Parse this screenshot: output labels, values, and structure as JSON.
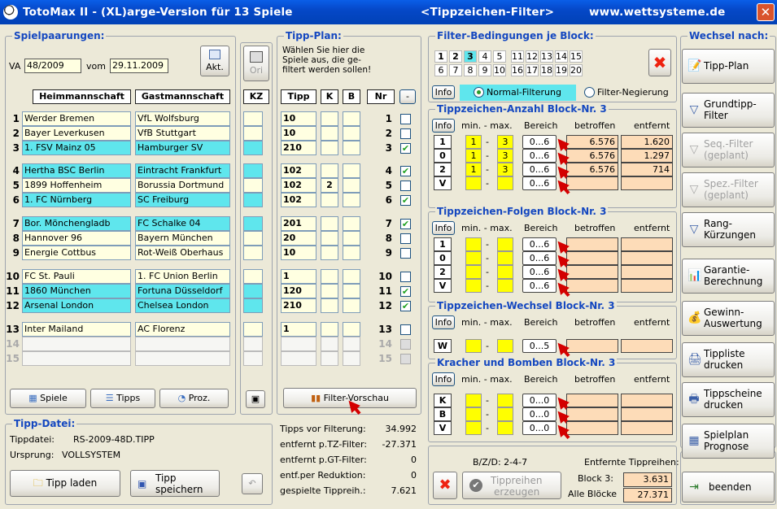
{
  "window": {
    "title": "TotoMax II - (XL)arge-Version für 13 Spiele",
    "subtitle": "<Tippzeichen-Filter>",
    "site": "www.wettsysteme.de",
    "close": "✕"
  },
  "spielpaarungen": {
    "legend": "Spielpaarungen:",
    "va_label": "VA",
    "va_value": "48/2009",
    "vom_label": "vom",
    "vom_value": "29.11.2009",
    "akt_label": "Akt.",
    "col_home": "Heimmannschaft",
    "col_away": "Gastmannschaft",
    "col_kz": "KZ",
    "ori_label": "Ori",
    "rows": [
      {
        "nr": "1",
        "home": "Werder Bremen",
        "away": "VfL Wolfsburg",
        "tipp": "10",
        "k": "",
        "b": "",
        "checked": false
      },
      {
        "nr": "2",
        "home": "Bayer Leverkusen",
        "away": "VfB Stuttgart",
        "tipp": "10",
        "k": "",
        "b": "",
        "checked": false
      },
      {
        "nr": "3",
        "home": "1. FSV Mainz 05",
        "away": "Hamburger SV",
        "tipp": "210",
        "k": "",
        "b": "",
        "checked": true
      },
      {
        "nr": "4",
        "home": "Hertha BSC Berlin",
        "away": "Eintracht Frankfurt",
        "tipp": "102",
        "k": "",
        "b": "",
        "checked": true
      },
      {
        "nr": "5",
        "home": "1899 Hoffenheim",
        "away": "Borussia Dortmund",
        "tipp": "102",
        "k": "2",
        "b": "",
        "checked": false
      },
      {
        "nr": "6",
        "home": "1. FC Nürnberg",
        "away": "SC Freiburg",
        "tipp": "102",
        "k": "",
        "b": "",
        "checked": true
      },
      {
        "nr": "7",
        "home": "Bor. Mönchengladb",
        "away": "FC Schalke 04",
        "tipp": "201",
        "k": "",
        "b": "",
        "checked": true
      },
      {
        "nr": "8",
        "home": "Hannover 96",
        "away": "Bayern München",
        "tipp": "20",
        "k": "",
        "b": "",
        "checked": false
      },
      {
        "nr": "9",
        "home": "Energie Cottbus",
        "away": "Rot-Weiß Oberhaus",
        "tipp": "10",
        "k": "",
        "b": "",
        "checked": false
      },
      {
        "nr": "10",
        "home": "FC St. Pauli",
        "away": "1. FC Union Berlin",
        "tipp": "1",
        "k": "",
        "b": "",
        "checked": false
      },
      {
        "nr": "11",
        "home": "1860 München",
        "away": "Fortuna Düsseldorf",
        "tipp": "120",
        "k": "",
        "b": "",
        "checked": true
      },
      {
        "nr": "12",
        "home": "Arsenal London",
        "away": "Chelsea London",
        "tipp": "210",
        "k": "",
        "b": "",
        "checked": true
      },
      {
        "nr": "13",
        "home": "Inter Mailand",
        "away": "AC Florenz",
        "tipp": "1",
        "k": "",
        "b": "",
        "checked": false
      },
      {
        "nr": "14",
        "home": "",
        "away": "",
        "tipp": "",
        "k": "",
        "b": "",
        "checked": false
      },
      {
        "nr": "15",
        "home": "",
        "away": "",
        "tipp": "",
        "k": "",
        "b": "",
        "checked": false
      }
    ],
    "btn_spiele": "Spiele",
    "btn_tipps": "Tipps",
    "btn_proz": "Proz."
  },
  "tippplan": {
    "legend": "Tipp-Plan:",
    "hint": "Wählen Sie hier die Spiele aus, die ge- filtert werden sollen!",
    "col_tipp": "Tipp",
    "col_k": "K",
    "col_b": "B",
    "col_nr": "Nr",
    "col_minus": "-",
    "btn_filter_vorschau": "Filter-Vorschau"
  },
  "tippdatei": {
    "legend": "Tipp-Datei:",
    "file_label": "Tippdatei:",
    "file_value": "RS-2009-48D.TIPP",
    "origin_label": "Ursprung:",
    "origin_value": "VOLLSYSTEM",
    "btn_laden": "Tipp laden",
    "btn_speichern_1": "Tipp",
    "btn_speichern_2": "speichern"
  },
  "stats": [
    {
      "label": "Tipps vor Filterung:",
      "value": "34.992"
    },
    {
      "label": "entfernt p.TZ-Filter:",
      "value": "-27.371"
    },
    {
      "label": "entfernt p.GT-Filter:",
      "value": "0"
    },
    {
      "label": "entf.per Reduktion:",
      "value": "0"
    },
    {
      "label": "gespielte Tippreih.:",
      "value": "7.621"
    }
  ],
  "filter": {
    "legend": "Filter-Bedingungen je Block:",
    "blocks_row1": [
      "1",
      "2",
      "3",
      "4",
      "5",
      "11",
      "12",
      "13",
      "14",
      "15"
    ],
    "blocks_row2": [
      "6",
      "7",
      "8",
      "9",
      "10",
      "16",
      "17",
      "18",
      "19",
      "20"
    ],
    "info": "Info",
    "normal": "Normal-Filterung",
    "negierung": "Filter-Negierung"
  },
  "anzahl": {
    "legend": "Tippzeichen-Anzahl Block-Nr. 3",
    "info": "Info",
    "minmax": "min. - max.",
    "bereich": "Bereich",
    "betroffen": "betroffen",
    "entfernt": "entfernt",
    "rows": [
      {
        "k": "1",
        "min": "1",
        "max": "3",
        "range": "0...6",
        "betroffen": "6.576",
        "entfernt": "1.620"
      },
      {
        "k": "0",
        "min": "1",
        "max": "3",
        "range": "0...6",
        "betroffen": "6.576",
        "entfernt": "1.297"
      },
      {
        "k": "2",
        "min": "1",
        "max": "3",
        "range": "0...6",
        "betroffen": "6.576",
        "entfernt": "714"
      },
      {
        "k": "V",
        "min": "",
        "max": "",
        "range": "0...6",
        "betroffen": "",
        "entfernt": ""
      }
    ]
  },
  "folgen": {
    "legend": "Tippzeichen-Folgen Block-Nr. 3",
    "info": "Info",
    "minmax": "min. - max.",
    "bereich": "Bereich",
    "betroffen": "betroffen",
    "entfernt": "entfernt",
    "rows": [
      {
        "k": "1",
        "range": "0...6"
      },
      {
        "k": "0",
        "range": "0...6"
      },
      {
        "k": "2",
        "range": "0...6"
      },
      {
        "k": "V",
        "range": "0...6"
      }
    ]
  },
  "wechsel": {
    "legend": "Tippzeichen-Wechsel Block-Nr. 3",
    "info": "Info",
    "minmax": "min. - max.",
    "bereich": "Bereich",
    "betroffen": "betroffen",
    "entfernt": "entfernt",
    "rows": [
      {
        "k": "W",
        "range": "0...5"
      }
    ]
  },
  "kracher": {
    "legend": "Kracher und Bomben Block-Nr. 3",
    "info": "Info",
    "minmax": "min. - max.",
    "bereich": "Bereich",
    "betroffen": "betroffen",
    "entfernt": "entfernt",
    "rows": [
      {
        "k": "K",
        "range": "0...0"
      },
      {
        "k": "B",
        "range": "0...0"
      },
      {
        "k": "V",
        "range": "0...0"
      }
    ]
  },
  "bottom": {
    "bzd": "B/Z/D:  2-4-7",
    "entfernte": "Entfernte Tippreihen:",
    "block3_label": "Block 3:",
    "block3_value": "3.631",
    "alle_label": "Alle Blöcke",
    "alle_value": "27.371",
    "btn_erzeugen_1": "Tippreihen",
    "btn_erzeugen_2": "erzeugen"
  },
  "wechsel_nach": {
    "legend": "Wechsel nach:",
    "buttons": [
      {
        "label": "Tipp-Plan",
        "icon": "📝",
        "disabled": false
      },
      {
        "label": "Grundtipp-\nFilter",
        "icon": "▽",
        "disabled": false
      },
      {
        "label": "Seq.-Filter\n(geplant)",
        "icon": "▽",
        "disabled": true
      },
      {
        "label": "Spez.-Filter\n(geplant)",
        "icon": "▽",
        "disabled": true
      },
      {
        "label": "Rang-\nKürzungen",
        "icon": "▽",
        "disabled": false
      },
      {
        "label": "Garantie-\nBerechnung",
        "icon": "📊",
        "disabled": false
      },
      {
        "label": "Gewinn-\nAuswertung",
        "icon": "💰",
        "disabled": false
      },
      {
        "label": "Tippliste\ndrucken",
        "icon": "🖨",
        "disabled": false
      },
      {
        "label": "Tippscheine\ndrucken",
        "icon": "🖶",
        "disabled": false
      },
      {
        "label": "Spielplan\nPrognose",
        "icon": "▦",
        "disabled": false
      }
    ],
    "beenden": "beenden"
  }
}
